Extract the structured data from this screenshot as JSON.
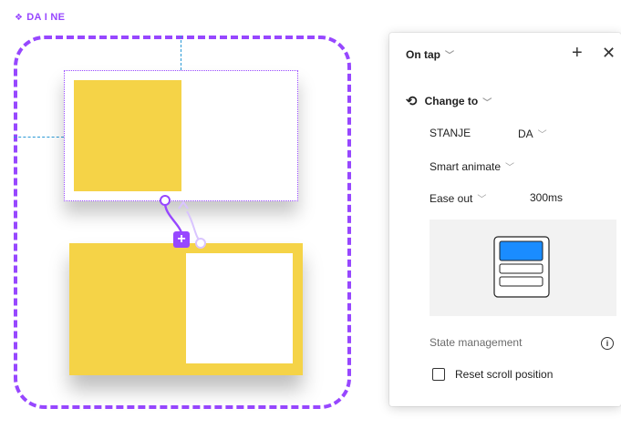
{
  "canvas": {
    "component_set_name": "DA I NE",
    "component_icon": "component-set-icon",
    "accent_color": "#9747ff",
    "fill_color": "#f5d347",
    "guide_color": "#2a9ad6",
    "connector_badge": "+"
  },
  "panel": {
    "trigger": "On tap",
    "add_icon": "plus-icon",
    "close_icon": "close-icon",
    "action": "Change to",
    "action_icon": "swap-icon",
    "property_name": "STANJE",
    "property_value": "DA",
    "animation": "Smart animate",
    "easing": "Ease out",
    "duration": "300ms",
    "preview_accent": "#1a8cff",
    "state_management_label": "State management",
    "info_icon": "info-icon",
    "reset_scroll_label": "Reset scroll position",
    "reset_scroll_checked": false
  }
}
